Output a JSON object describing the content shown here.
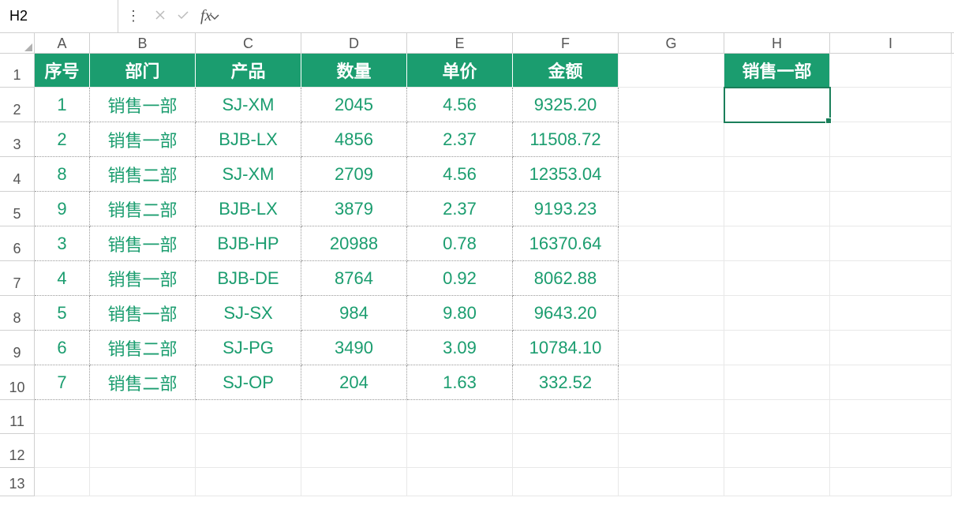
{
  "name_box": "H2",
  "formula": "",
  "columns": [
    "A",
    "B",
    "C",
    "D",
    "E",
    "F",
    "G",
    "H",
    "I"
  ],
  "row_numbers": [
    1,
    2,
    3,
    4,
    5,
    6,
    7,
    8,
    9,
    10,
    11,
    12,
    13
  ],
  "headers": {
    "A": "序号",
    "B": "部门",
    "C": "产品",
    "D": "数量",
    "E": "单价",
    "F": "金额"
  },
  "lookup_header": "销售一部",
  "data": [
    {
      "seq": "1",
      "dept": "销售一部",
      "prod": "SJ-XM",
      "qty": "2045",
      "price": "4.56",
      "amount": "9325.20"
    },
    {
      "seq": "2",
      "dept": "销售一部",
      "prod": "BJB-LX",
      "qty": "4856",
      "price": "2.37",
      "amount": "11508.72"
    },
    {
      "seq": "8",
      "dept": "销售二部",
      "prod": "SJ-XM",
      "qty": "2709",
      "price": "4.56",
      "amount": "12353.04"
    },
    {
      "seq": "9",
      "dept": "销售二部",
      "prod": "BJB-LX",
      "qty": "3879",
      "price": "2.37",
      "amount": "9193.23"
    },
    {
      "seq": "3",
      "dept": "销售一部",
      "prod": "BJB-HP",
      "qty": "20988",
      "price": "0.78",
      "amount": "16370.64"
    },
    {
      "seq": "4",
      "dept": "销售一部",
      "prod": "BJB-DE",
      "qty": "8764",
      "price": "0.92",
      "amount": "8062.88"
    },
    {
      "seq": "5",
      "dept": "销售一部",
      "prod": "SJ-SX",
      "qty": "984",
      "price": "9.80",
      "amount": "9643.20"
    },
    {
      "seq": "6",
      "dept": "销售二部",
      "prod": "SJ-PG",
      "qty": "3490",
      "price": "3.09",
      "amount": "10784.10"
    },
    {
      "seq": "7",
      "dept": "销售二部",
      "prod": "SJ-OP",
      "qty": "204",
      "price": "1.63",
      "amount": "332.52"
    }
  ],
  "colors": {
    "accent": "#1b9d6f",
    "selection": "#1b7f5a"
  }
}
